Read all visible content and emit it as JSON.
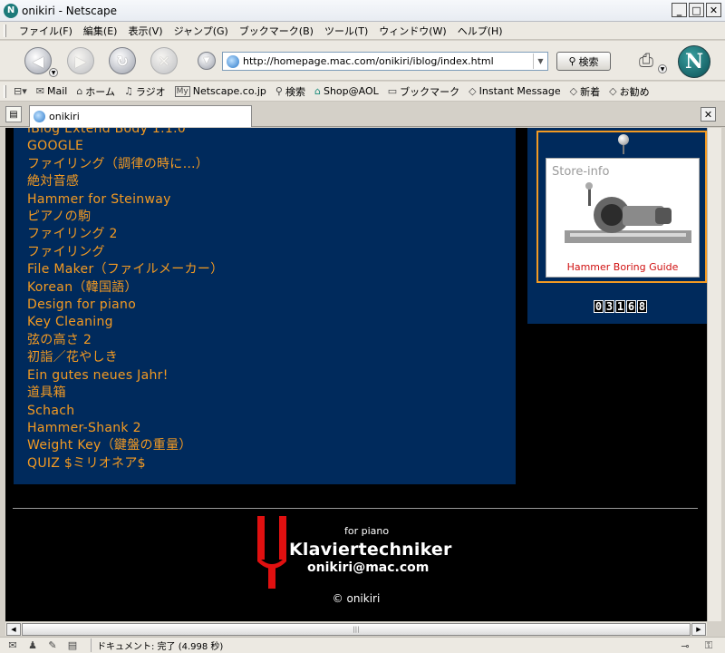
{
  "window": {
    "title": "onikiri - Netscape",
    "app_icon": "N"
  },
  "menu": [
    "ファイル(F)",
    "編集(E)",
    "表示(V)",
    "ジャンプ(G)",
    "ブックマーク(B)",
    "ツール(T)",
    "ウィンドウ(W)",
    "ヘルプ(H)"
  ],
  "nav": {
    "url": "http://homepage.mac.com/onikiri/iblog/index.html",
    "search_label": "検索",
    "logo": "N"
  },
  "personal_toolbar": [
    {
      "label": "Mail",
      "icon": "mail-icon",
      "glyph": "✉"
    },
    {
      "label": "ホーム",
      "icon": "home-icon",
      "glyph": "⌂"
    },
    {
      "label": "ラジオ",
      "icon": "radio-icon",
      "glyph": "♫"
    },
    {
      "label": "Netscape.co.jp",
      "icon": "my-netscape-icon",
      "glyph": "My"
    },
    {
      "label": "検索",
      "icon": "search-icon",
      "glyph": "⚲"
    },
    {
      "label": "Shop@AOL",
      "icon": "shop-icon",
      "glyph": "⌂"
    },
    {
      "label": "ブックマーク",
      "icon": "bookmark-folder-icon",
      "glyph": "▭"
    },
    {
      "label": "Instant Message",
      "icon": "bookmark-icon",
      "glyph": "◇"
    },
    {
      "label": "新着",
      "icon": "bookmark-icon",
      "glyph": "◇"
    },
    {
      "label": "お勧め",
      "icon": "bookmark-icon",
      "glyph": "◇"
    }
  ],
  "tab": {
    "title": "onikiri"
  },
  "blog": {
    "entries": [
      "iBlog Extend Body 1.1.0",
      "GOOGLE",
      "ファイリング（調律の時に…）",
      "絶対音感",
      "Hammer for Steinway",
      "ピアノの駒",
      "ファイリング 2",
      "ファイリング",
      "File Maker（ファイルメーカー）",
      "Korean（韓国語）",
      "Design for piano",
      "Key Cleaning",
      "弦の高さ 2",
      "初詣／花やしき",
      "Ein gutes neues Jahr!",
      "道具箱",
      "Schach",
      "Hammer-Shank 2",
      "Weight Key（鍵盤の重量）",
      "QUIZ $ミリオネア$"
    ]
  },
  "sidebar": {
    "store_title": "Store-info",
    "store_caption": "Hammer Boring Guide",
    "counter_digits": [
      "0",
      "3",
      "1",
      "6",
      "8"
    ]
  },
  "footer": {
    "for_piano": "for piano",
    "brand": "Klaviertechniker",
    "email": "onikiri@mac.com",
    "copyright": "© onikiri"
  },
  "status": {
    "text": "ドキュメント: 完了 (4.998 秒)"
  },
  "colors": {
    "entry": "#f39a22",
    "panel": "#002a5c",
    "logo_red": "#e01010"
  }
}
